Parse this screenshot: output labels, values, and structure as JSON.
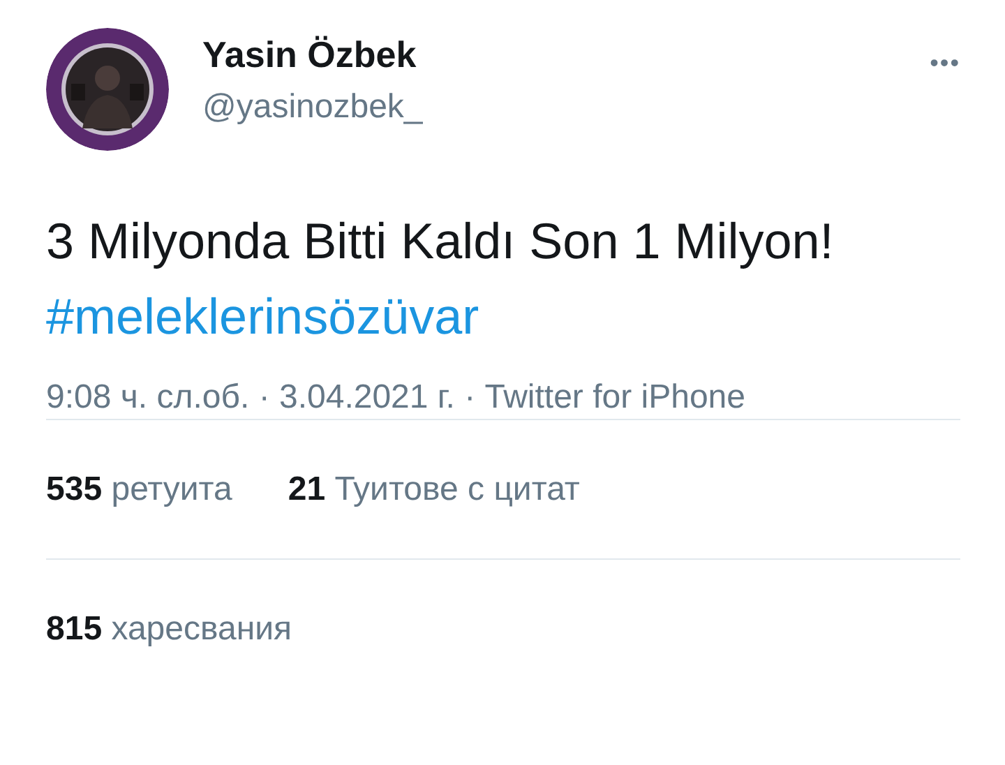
{
  "author": {
    "name": "Yasin Özbek",
    "handle": "@yasinozbek_"
  },
  "more_menu": "•••",
  "tweet": {
    "text": "3 Milyonda Bitti Kaldı Son 1 Milyon!",
    "hashtag": "#meleklerinsözüvar"
  },
  "meta": "9:08 ч. сл.об. · 3.04.2021 г. · Twitter for iPhone",
  "stat_rows": [
    [
      {
        "count": "535",
        "label": "ретуита"
      },
      {
        "count": "21",
        "label": "Туитове с цитат"
      }
    ],
    [
      {
        "count": "815",
        "label": "харесвания"
      }
    ]
  ]
}
